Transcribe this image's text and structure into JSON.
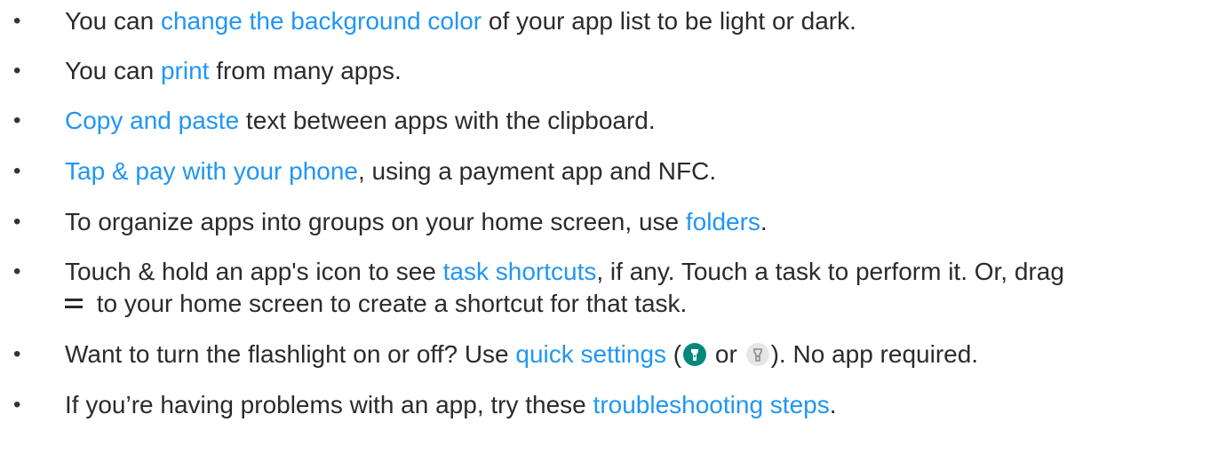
{
  "bullet_char": "•",
  "tips": [
    {
      "before": "You can ",
      "link": "change the background color",
      "after": " of your app list to be light or dark."
    },
    {
      "before": "You can ",
      "link": "print",
      "after": " from many apps."
    },
    {
      "before": "",
      "link": "Copy and paste",
      "after": " text between apps with the clipboard."
    },
    {
      "before": "",
      "link": "Tap & pay with your phone",
      "after": ", using a payment app and NFC."
    },
    {
      "before": "To organize apps into groups on your home screen, use ",
      "link": "folders",
      "after": "."
    },
    {
      "before": "Touch & hold an app's icon to see ",
      "link": "task shortcuts",
      "after": ", if any. Touch a task to perform it. Or, drag",
      "line2": " to your home screen to create a shortcut for that task.",
      "line2_icon": "drag-handle-icon"
    },
    {
      "before": "Want to turn the flashlight on or off? Use ",
      "link": "quick settings",
      "after_open": " (",
      "icon_on": "flashlight-on-icon",
      "or_text": " or ",
      "icon_off": "flashlight-off-icon",
      "after_close": "). No app required."
    },
    {
      "before": "If you’re having problems with an app, try these ",
      "link": "troubleshooting steps",
      "after": "."
    }
  ],
  "colors": {
    "text": "#2b2b2b",
    "link": "#2196f3",
    "flashlight_on_bg": "#00897b",
    "flashlight_off_bg": "#e6e6e6"
  }
}
